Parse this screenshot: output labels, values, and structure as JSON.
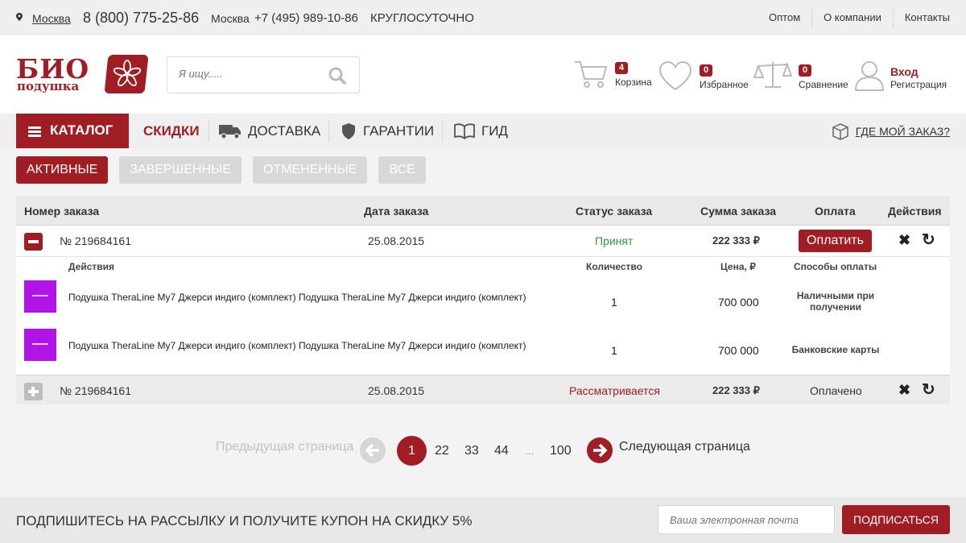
{
  "colors": {
    "brand": "#a01d24",
    "accepted": "#2f9d3e",
    "review": "#a01d24"
  },
  "topbar": {
    "city": "Москва",
    "phone_main": "8 (800) 775-25-86",
    "city2": "Москва",
    "phone_city": "+7 (495) 989-10-86",
    "hours": "КРУГЛОСУТОЧНО",
    "links": [
      "Оптом",
      "О компании",
      "Контакты"
    ]
  },
  "header": {
    "logo_top": "БИО",
    "logo_bottom": "подушка",
    "search_placeholder": "Я ищу.....",
    "cart": {
      "count": "4",
      "label": "Корзина"
    },
    "favorites": {
      "count": "0",
      "label": "Избранное"
    },
    "compare": {
      "count": "0",
      "label": "Сравнение"
    },
    "login": "Вход",
    "register": "Регистрация"
  },
  "nav": {
    "catalog": "КАТАЛОГ",
    "sale": "СКИДКИ",
    "delivery": "ДОСТАВКА",
    "guarantee": "ГАРАНТИИ",
    "guide": "ГИД",
    "where_order": "ГДЕ МОЙ ЗАКАЗ?"
  },
  "tabs": [
    "АКТИВНЫЕ",
    "ЗАВЕРШЕННЫЕ",
    "ОТМЕНЕННЫЕ",
    "ВСЕ"
  ],
  "table": {
    "headers": [
      "Номер заказа",
      "Дата заказа",
      "Статус заказа",
      "Сумма заказа",
      "Оплата",
      "Действия"
    ],
    "orders": [
      {
        "number": "№ 219684161",
        "date": "25.08.2015",
        "status": "Принят",
        "sum": "222 333 ₽",
        "pay": "Оплатить"
      },
      {
        "number": "№ 219684161",
        "date": "25.08.2015",
        "status": "Рассматривается",
        "sum": "222 333 ₽",
        "pay": "Оплачено"
      }
    ],
    "details_headers": [
      "Действия",
      "Количество",
      "Цена, ₽",
      "Способы оплаты"
    ],
    "items": [
      {
        "name": "Подушка TheraLine My7 Джерси индиго (комплект) Подушка TheraLine My7 Джерси индиго (комплект)",
        "qty": "1",
        "price": "700 000",
        "payment": "Наличными при получении"
      },
      {
        "name": "Подушка TheraLine My7 Джерси индиго (комплект) Подушка TheraLine My7 Джерси индиго (комплект)",
        "qty": "1",
        "price": "700 000",
        "payment": "Банковские карты"
      }
    ]
  },
  "pagination": {
    "prev": "Предыдущая страница",
    "current": "1",
    "pages": [
      "22",
      "33",
      "44",
      "...",
      "100"
    ],
    "next": "Следующая страница"
  },
  "subscribe": {
    "text": "ПОДПИШИТЕСЬ НА РАССЫЛКУ И ПОЛУЧИТЕ КУПОН НА СКИДКУ 5%",
    "placeholder": "Ваша электронная почта",
    "button": "ПОДПИСАТЬСЯ"
  }
}
